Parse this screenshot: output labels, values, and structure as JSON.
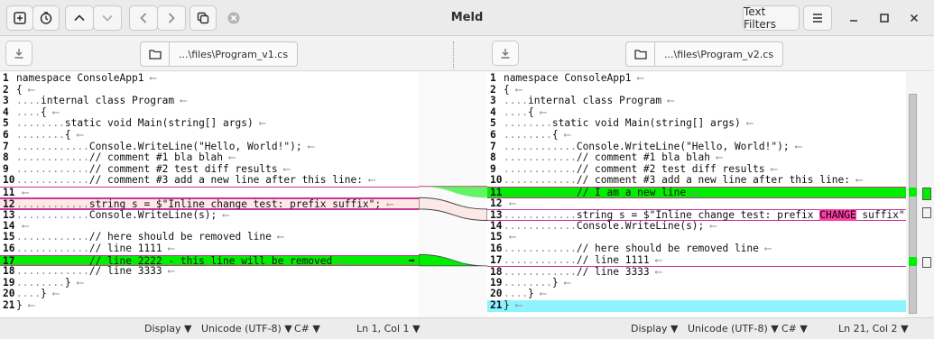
{
  "app": {
    "title": "Meld",
    "text_filters_label": "Text Filters"
  },
  "left": {
    "file_label": "...\\files\\Program_v1.cs",
    "status": {
      "display": "Display",
      "encoding": "Unicode (UTF-8)",
      "language": "C#",
      "position": "Ln 1, Col 1"
    },
    "lines": [
      {
        "n": "1",
        "t": "namespace ConsoleApp1"
      },
      {
        "n": "2",
        "t": "{"
      },
      {
        "n": "3",
        "t": "    internal class Program"
      },
      {
        "n": "4",
        "t": "    {"
      },
      {
        "n": "5",
        "t": "        static void Main(string[] args)"
      },
      {
        "n": "6",
        "t": "        {"
      },
      {
        "n": "7",
        "t": "            Console.WriteLine(\"Hello, World!\");"
      },
      {
        "n": "8",
        "t": "            // comment #1 bla blah"
      },
      {
        "n": "9",
        "t": "            // comment #2 test diff results"
      },
      {
        "n": "10",
        "t": "            // comment #3 add a new line after this line:"
      },
      {
        "n": "11",
        "t": ""
      },
      {
        "n": "12",
        "t": "            string s = $\"Inline change test: prefix suffix\";"
      },
      {
        "n": "13",
        "t": "            Console.WriteLine(s);"
      },
      {
        "n": "14",
        "t": ""
      },
      {
        "n": "15",
        "t": "            // here should be removed line"
      },
      {
        "n": "16",
        "t": "            // line 1111"
      },
      {
        "n": "17",
        "t": "            // line 2222 - this line will be removed"
      },
      {
        "n": "18",
        "t": "            // line 3333"
      },
      {
        "n": "19",
        "t": "        }"
      },
      {
        "n": "20",
        "t": "    }"
      },
      {
        "n": "21",
        "t": "}"
      }
    ]
  },
  "right": {
    "file_label": "...\\files\\Program_v2.cs",
    "status": {
      "display": "Display",
      "encoding": "Unicode (UTF-8)",
      "language": "C#",
      "position": "Ln 21, Col 2"
    },
    "lines": [
      {
        "n": "1",
        "t": "namespace ConsoleApp1"
      },
      {
        "n": "2",
        "t": "{"
      },
      {
        "n": "3",
        "t": "    internal class Program"
      },
      {
        "n": "4",
        "t": "    {"
      },
      {
        "n": "5",
        "t": "        static void Main(string[] args)"
      },
      {
        "n": "6",
        "t": "        {"
      },
      {
        "n": "7",
        "t": "            Console.WriteLine(\"Hello, World!\");"
      },
      {
        "n": "8",
        "t": "            // comment #1 bla blah"
      },
      {
        "n": "9",
        "t": "            // comment #2 test diff results"
      },
      {
        "n": "10",
        "t": "            // comment #3 add a new line after this line:"
      },
      {
        "n": "11",
        "t": "            // I am a new line"
      },
      {
        "n": "12",
        "t": ""
      },
      {
        "n": "13",
        "t": "            string s = $\"Inline change test: prefix ",
        "hl": "CHANGE",
        "after": " suffix\""
      },
      {
        "n": "14",
        "t": "            Console.WriteLine(s);"
      },
      {
        "n": "15",
        "t": ""
      },
      {
        "n": "16",
        "t": "            // here should be removed line"
      },
      {
        "n": "17",
        "t": "            // line 1111"
      },
      {
        "n": "18",
        "t": "            // line 3333"
      },
      {
        "n": "19",
        "t": "        }"
      },
      {
        "n": "20",
        "t": "    }"
      },
      {
        "n": "21",
        "t": "}"
      }
    ]
  },
  "colors": {
    "added": "#00ee00",
    "changed_bg": "#fde8e8",
    "inline_change": "#ff3fa8",
    "current_line": "#8ef3ff",
    "border_pink": "#cc3399"
  },
  "icons": [
    "new-comparison-icon",
    "history-icon",
    "previous-change-icon",
    "next-change-icon",
    "back-icon",
    "forward-icon",
    "copy-icon",
    "stop-icon",
    "menu-icon",
    "minimize-icon",
    "maximize-icon",
    "close-icon",
    "save-icon",
    "open-folder-icon",
    "chevron-down-icon",
    "arrow-right-icon",
    "arrow-left-icon"
  ]
}
